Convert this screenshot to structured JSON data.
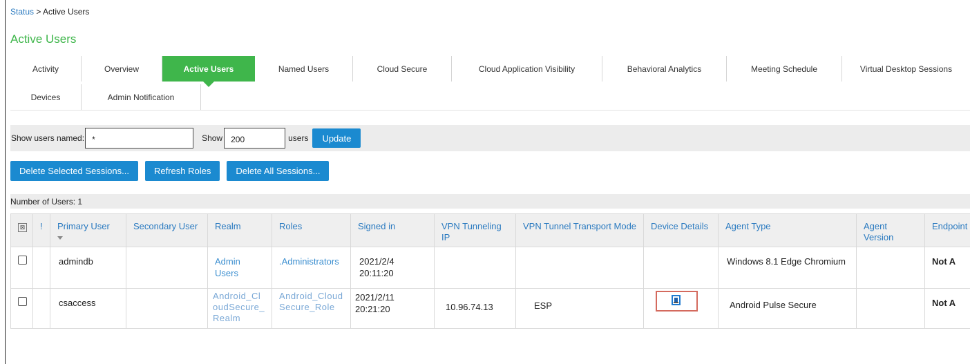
{
  "breadcrumb": {
    "link": "Status",
    "separator": " > ",
    "current": "Active Users"
  },
  "page_title": "Active Users",
  "tabs_row1": [
    "Activity",
    "Overview",
    "Active Users",
    "Named Users",
    "Cloud Secure",
    "Cloud Application Visibility",
    "Behavioral Analytics",
    "Meeting Schedule",
    "Virtual Desktop Sessions"
  ],
  "tabs_row2": [
    "Devices",
    "Admin Notification"
  ],
  "active_tab": "Active Users",
  "filter": {
    "show_users_named_label": "Show users named:",
    "name_value": "*",
    "show_label": "Show",
    "count_value": "200",
    "users_label": "users",
    "update_button": "Update"
  },
  "actions": {
    "delete_selected": "Delete Selected Sessions...",
    "refresh_roles": "Refresh Roles",
    "delete_all": "Delete All Sessions..."
  },
  "user_count": "Number of Users: 1",
  "table": {
    "select_all_symbol": "⊠",
    "flag_header": "!",
    "headers": [
      "Primary User",
      "Secondary User",
      "Realm",
      "Roles",
      "Signed in",
      "VPN Tunneling IP",
      "VPN Tunnel Transport Mode",
      "Device Details",
      "Agent Type",
      "Agent Version",
      "Endpoint Status"
    ],
    "rows": [
      {
        "primary_user": "admindb",
        "secondary_user": "",
        "realm": "Admin Users",
        "roles": ".Administrators",
        "signed_in": "2021/2/4 20:11:20",
        "vpn_ip": "",
        "transport": "",
        "agent_type": "Windows 8.1 Edge Chromium",
        "agent_version": "",
        "endpoint_status": "Not A"
      },
      {
        "primary_user": "csaccess",
        "secondary_user": "",
        "realm": "Android_CloudSecure_Realm",
        "roles": "Android_CloudSecure_Role",
        "signed_in": "2021/2/11 20:21:20",
        "vpn_ip": "10.96.74.13",
        "transport": "ESP",
        "device_icon": "device-details-icon",
        "agent_type": "Android Pulse Secure",
        "agent_version": "",
        "endpoint_status": "Not A"
      }
    ]
  },
  "colors": {
    "accent_green": "#3fb64b",
    "button_blue": "#1b8ad0",
    "link_blue": "#2a7ac0",
    "highlight_red": "#d46a5e"
  }
}
